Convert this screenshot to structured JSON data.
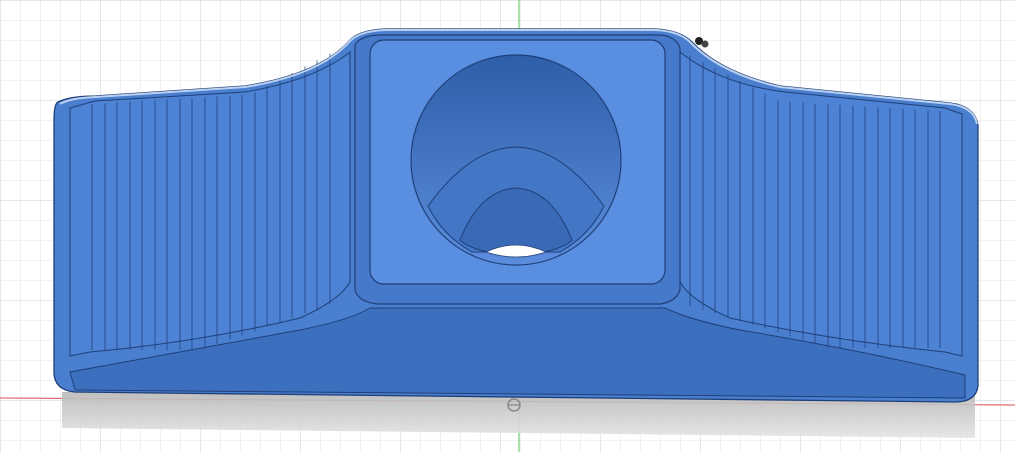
{
  "viewport": {
    "background": "#ffffff",
    "grid_minor_color": "#e6e6e6",
    "grid_major_color": "#cfcfcf",
    "axis_x_color": "#e07070",
    "axis_y_color": "#6fcf6f"
  },
  "model": {
    "base_color": "#4a7fd0",
    "top_face_color": "#5a8ee0",
    "dark_face_color": "#3c6fbd",
    "edge_color": "#1f3f78",
    "highlight_color": "#c8dcf6",
    "shadow_color": "#c4c4c4"
  }
}
